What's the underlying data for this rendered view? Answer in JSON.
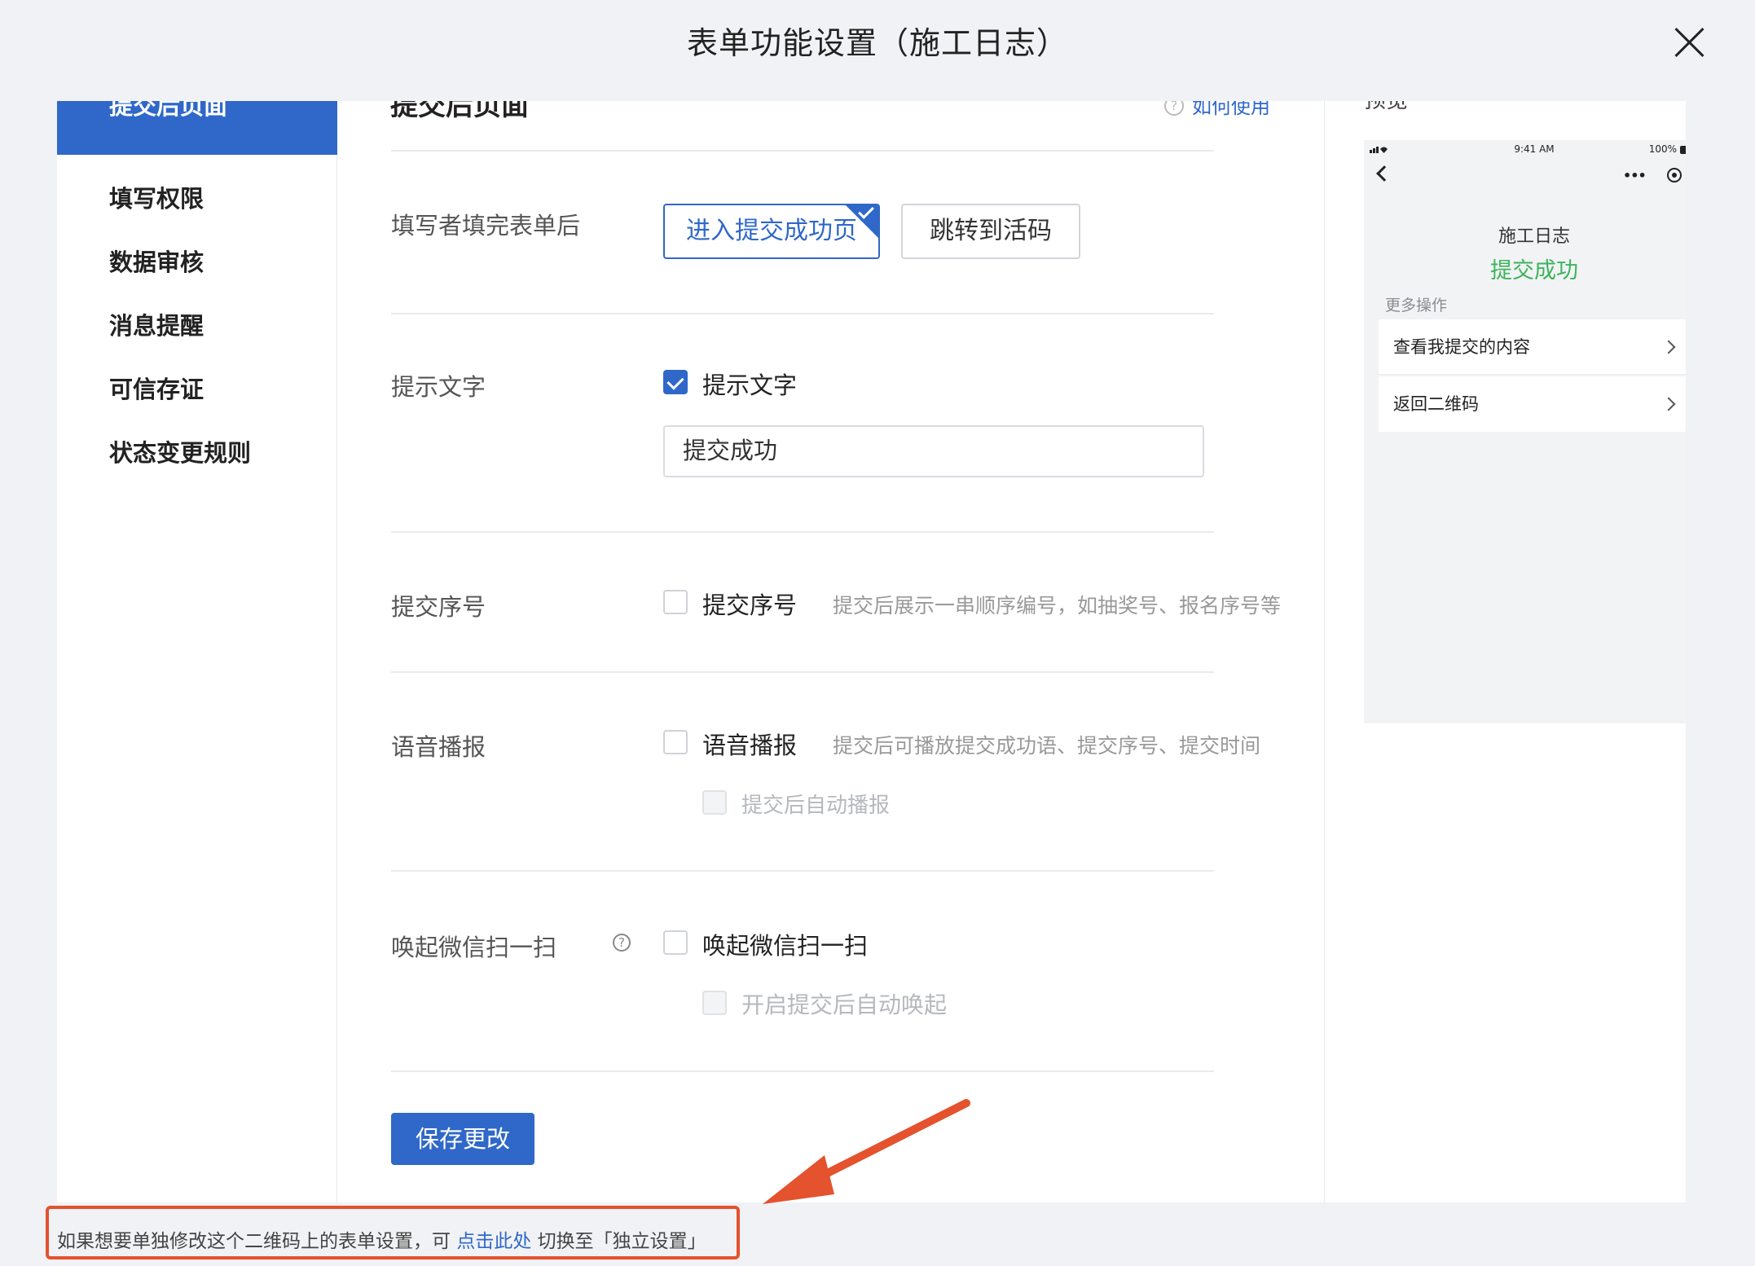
{
  "dialog": {
    "title": "表单功能设置（施工日志）"
  },
  "sidebar": {
    "items": [
      {
        "label": "提交后页面"
      },
      {
        "label": "填写权限"
      },
      {
        "label": "数据审核"
      },
      {
        "label": "消息提醒"
      },
      {
        "label": "可信存证"
      },
      {
        "label": "状态变更规则"
      }
    ]
  },
  "main": {
    "section_title": "提交后页面",
    "howto_label": "如何使用",
    "after_submit": {
      "label": "填写者填完表单后",
      "options": [
        "进入提交成功页",
        "跳转到活码"
      ],
      "selected": "进入提交成功页"
    },
    "prompt_text": {
      "label": "提示文字",
      "checkbox_label": "提示文字",
      "checked": true,
      "input_value": "提交成功"
    },
    "serial_number": {
      "label": "提交序号",
      "checkbox_label": "提交序号",
      "hint": "提交后展示一串顺序编号，如抽奖号、报名序号等",
      "checked": false
    },
    "voice": {
      "label": "语音播报",
      "checkbox_label": "语音播报",
      "hint": "提交后可播放提交成功语、提交序号、提交时间",
      "sub_label": "提交后自动播报",
      "checked": false
    },
    "wechat_scan": {
      "label": "唤起微信扫一扫",
      "checkbox_label": "唤起微信扫一扫",
      "sub_label": "开启提交后自动唤起",
      "checked": false
    },
    "save_label": "保存更改"
  },
  "preview": {
    "label": "预览",
    "status_time": "9:41 AM",
    "battery": "100%",
    "form_title": "施工日志",
    "success_text": "提交成功",
    "more_label": "更多操作",
    "items": [
      "查看我提交的内容",
      "返回二维码"
    ]
  },
  "footer_note": {
    "prefix": "如果想要单独修改这个二维码上的表单设置，可",
    "link": "点击此处",
    "suffix": "切换至「独立设置」"
  },
  "colors": {
    "accent": "#2f68c8",
    "success": "#3cb45a",
    "annotation": "#e4522e"
  }
}
